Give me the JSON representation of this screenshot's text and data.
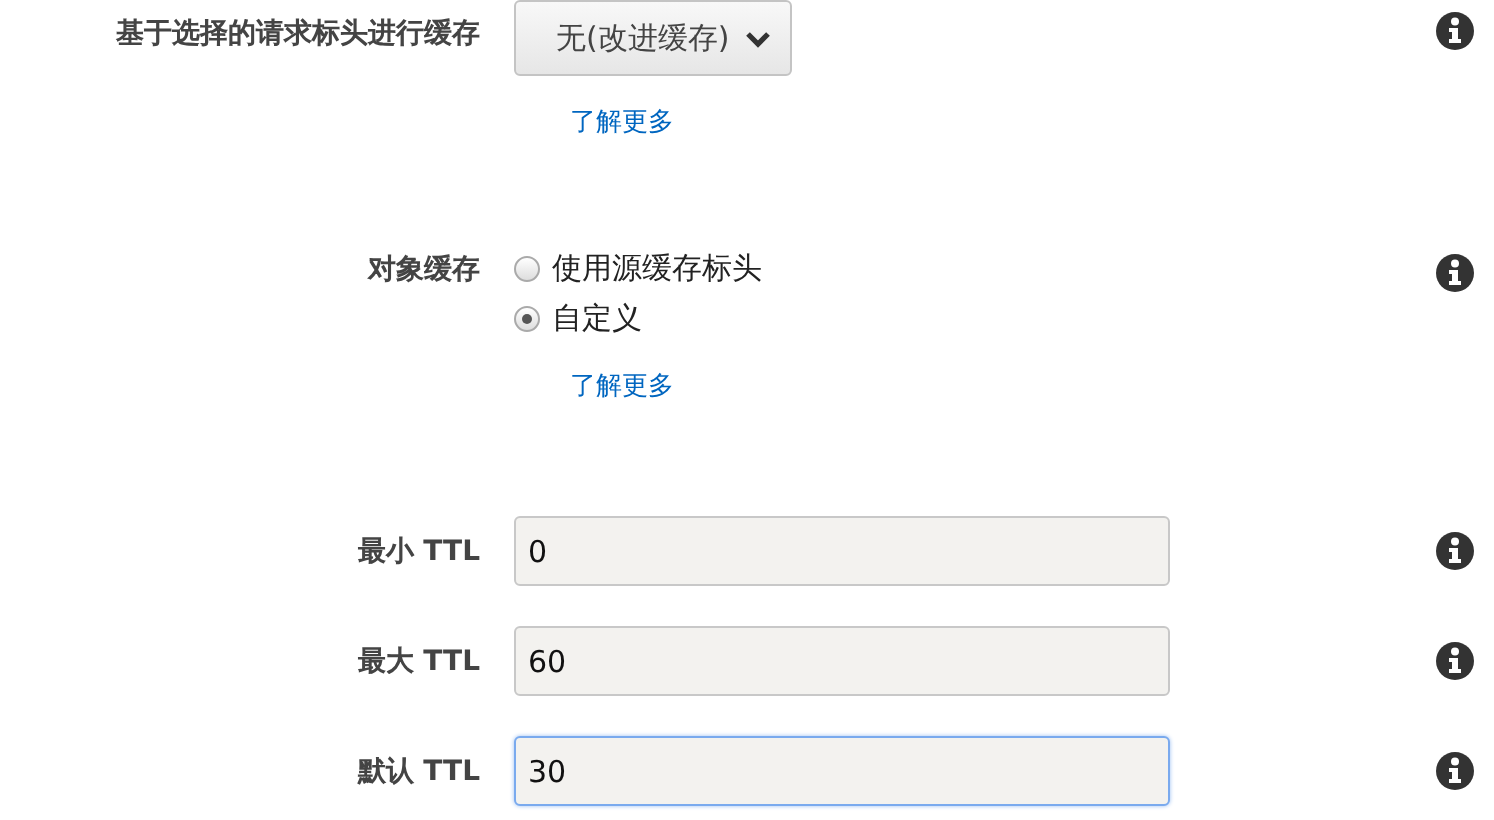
{
  "settings": [
    {
      "kind": "select",
      "label": "基于选择的请求标头进行缓存",
      "value": "无(改进缓存)",
      "link": "了解更多"
    },
    {
      "kind": "radio",
      "label": "对象缓存",
      "options": [
        {
          "label": "使用源缓存标头",
          "selected": false
        },
        {
          "label": "自定义",
          "selected": true
        }
      ],
      "link": "了解更多"
    },
    {
      "kind": "input",
      "label": "最小 TTL",
      "value": "0",
      "focused": false
    },
    {
      "kind": "input",
      "label": "最大 TTL",
      "value": "60",
      "focused": false
    },
    {
      "kind": "input",
      "label": "默认 TTL",
      "value": "30",
      "focused": true
    }
  ]
}
